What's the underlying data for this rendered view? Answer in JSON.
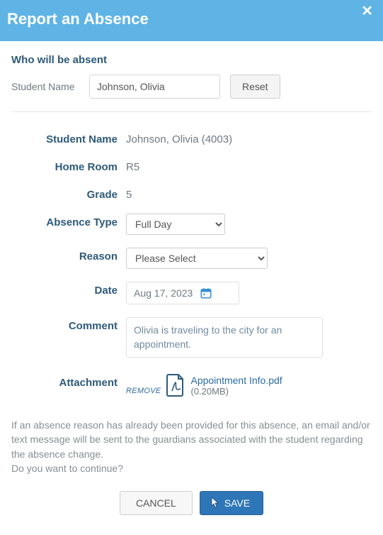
{
  "header": {
    "title": "Report an Absence"
  },
  "who": {
    "section_title": "Who will be absent",
    "student_name_label": "Student Name",
    "student_name_value": "Johnson, Olivia",
    "reset_label": "Reset"
  },
  "details": {
    "student_name_label": "Student Name",
    "student_name_value": "Johnson, Olivia (4003)",
    "home_room_label": "Home Room",
    "home_room_value": "R5",
    "grade_label": "Grade",
    "grade_value": "5",
    "absence_type_label": "Absence Type",
    "absence_type_value": "Full Day",
    "reason_label": "Reason",
    "reason_value": "Please Select",
    "date_label": "Date",
    "date_value": "Aug 17, 2023",
    "comment_label": "Comment",
    "comment_value": "Olivia is traveling to the city for an appointment.",
    "attachment_label": "Attachment",
    "attachment_remove": "REMOVE",
    "attachment_name": "Appointment Info.pdf",
    "attachment_size": "(0.20MB)"
  },
  "notice": {
    "line1": "If an absence reason has already been provided for this absence, an email and/or text message will be sent to the guardians associated with the student regarding the absence change.",
    "line2": "Do you want to continue?"
  },
  "actions": {
    "cancel": "CANCEL",
    "save": "SAVE"
  }
}
